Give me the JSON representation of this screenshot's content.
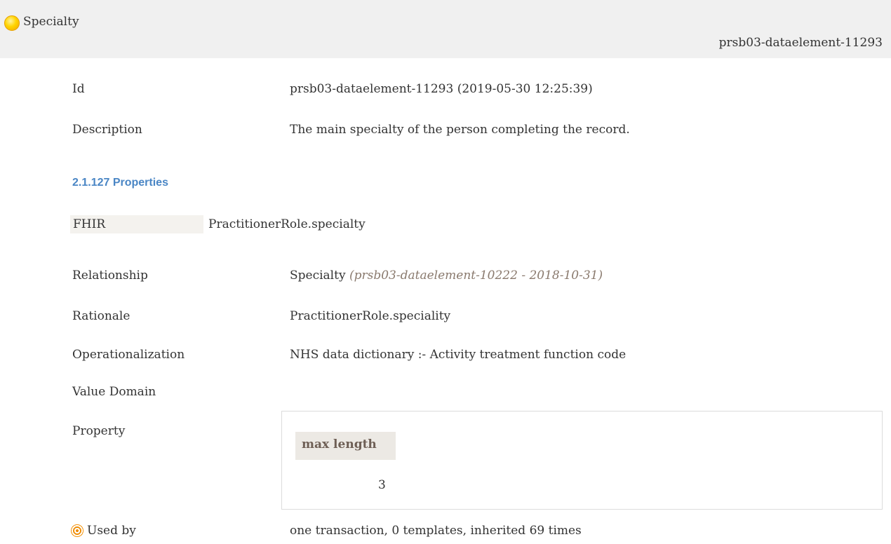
{
  "header": {
    "title": "Specialty",
    "id": "prsb03-dataelement-11293"
  },
  "rows": {
    "id": {
      "label": "Id",
      "value": "prsb03-dataelement-11293 (2019-05-30 12:25:39)"
    },
    "description": {
      "label": "Description",
      "value": "The main specialty of the person completing the record."
    }
  },
  "properties_section": {
    "heading": "2.1.127 Properties",
    "fhir": {
      "label": "FHIR",
      "value": "PractitionerRole.specialty"
    },
    "relationship": {
      "label": "Relationship",
      "value": "Specialty",
      "detail": "(prsb03-dataelement-10222 - 2018-10-31)"
    },
    "rationale": {
      "label": "Rationale",
      "value": "PractitionerRole.speciality"
    },
    "operationalization": {
      "label": "Operationalization",
      "value": "NHS data dictionary :- Activity treatment function code"
    },
    "value_domain": {
      "label": "Value Domain"
    },
    "property": {
      "label": "Property",
      "column_header": "max length",
      "column_value": "3"
    },
    "used_by": {
      "label": "Used by",
      "value": "one transaction, 0 templates, inherited 69 times"
    }
  },
  "icons": {
    "status": "status-dot-icon",
    "used_by": "target-icon"
  },
  "colors": {
    "header_bg": "#f0f0f0",
    "heading": "#4a86c5",
    "status_dot": "#ffd400",
    "used_by_icon": "#f08c00"
  }
}
